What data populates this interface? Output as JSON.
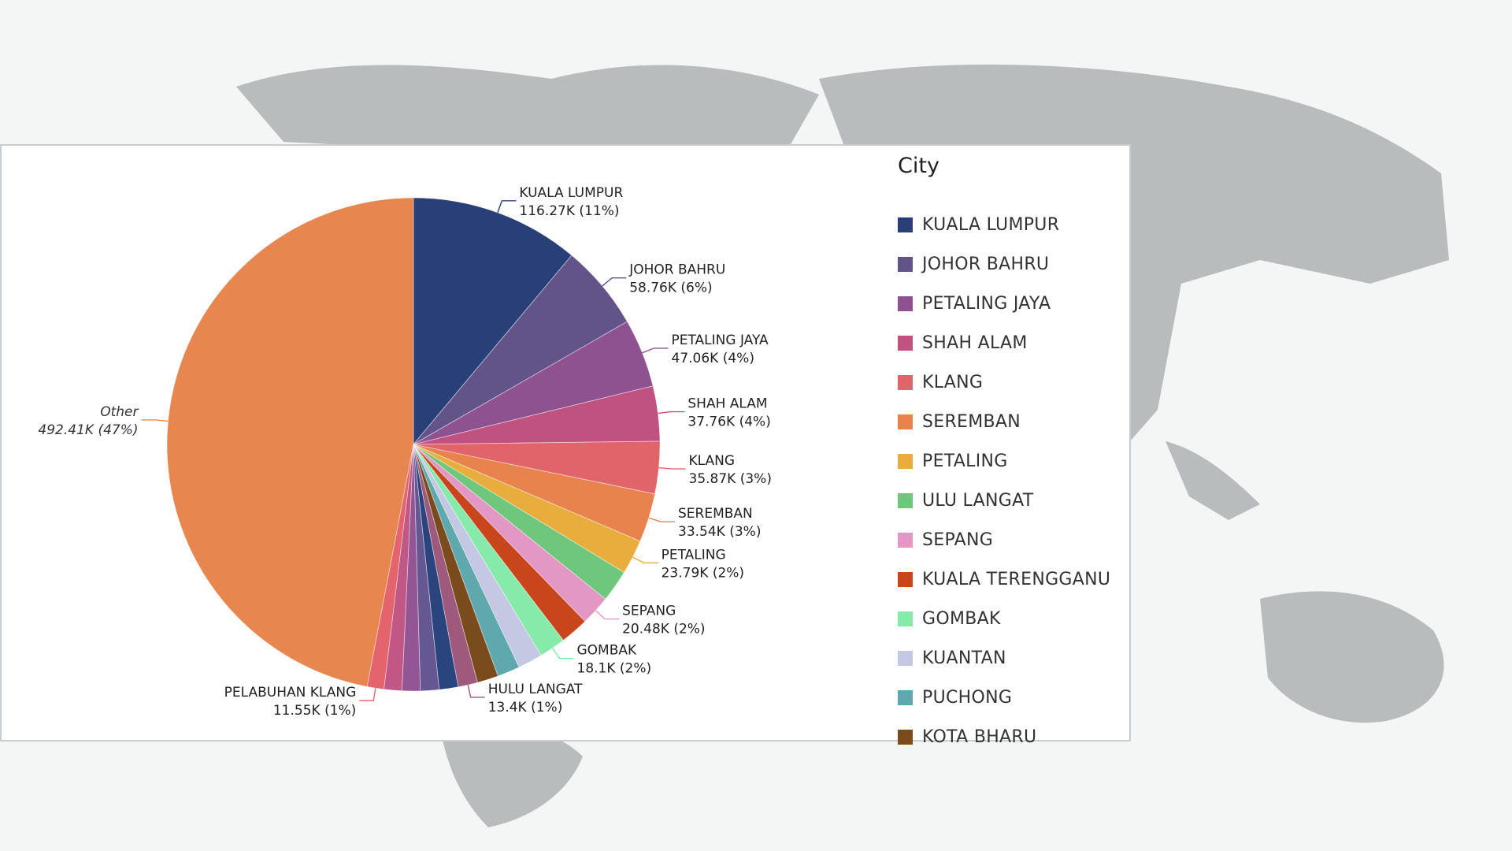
{
  "chart_data": {
    "type": "pie",
    "legend_title": "City",
    "legend_position": "right",
    "slices": [
      {
        "label": "KUALA LUMPUR",
        "value": 116270,
        "value_text": "116.27K (11%)",
        "color": "#283f77"
      },
      {
        "label": "JOHOR BAHRU",
        "value": 58760,
        "value_text": "58.76K (6%)",
        "color": "#625389"
      },
      {
        "label": "PETALING JAYA",
        "value": 47060,
        "value_text": "47.06K (4%)",
        "color": "#8f5291"
      },
      {
        "label": "SHAH ALAM",
        "value": 37760,
        "value_text": "37.76K (4%)",
        "color": "#bf527f"
      },
      {
        "label": "KLANG",
        "value": 35870,
        "value_text": "35.87K (3%)",
        "color": "#e1646a"
      },
      {
        "label": "SEREMBAN",
        "value": 33540,
        "value_text": "33.54K (3%)",
        "color": "#e8834d"
      },
      {
        "label": "PETALING",
        "value": 23790,
        "value_text": "23.79K (2%)",
        "color": "#e9ad3e"
      },
      {
        "label": "ULU LANGAT",
        "value": 22000,
        "value_text": "",
        "color": "#6fc77c"
      },
      {
        "label": "SEPANG",
        "value": 20480,
        "value_text": "20.48K (2%)",
        "color": "#e397c5"
      },
      {
        "label": "KUALA TERENGGANU",
        "value": 19500,
        "value_text": "",
        "color": "#c9461d"
      },
      {
        "label": "GOMBAK",
        "value": 18100,
        "value_text": "18.1K (2%)",
        "color": "#86eaaa"
      },
      {
        "label": "KUANTAN",
        "value": 17000,
        "value_text": "",
        "color": "#c5c8e3"
      },
      {
        "label": "PUCHONG",
        "value": 15500,
        "value_text": "",
        "color": "#5fa8ae"
      },
      {
        "label": "KOTA BHARU",
        "value": 14500,
        "value_text": "",
        "color": "#7a4b1c"
      },
      {
        "label": "HULU LANGAT",
        "value": 13400,
        "value_text": "13.4K (1%)",
        "color": "#9d5a7c"
      },
      {
        "label": "",
        "value": 13000,
        "value_text": "",
        "color": "#2a447e"
      },
      {
        "label": "",
        "value": 12800,
        "value_text": "",
        "color": "#655892"
      },
      {
        "label": "",
        "value": 12500,
        "value_text": "",
        "color": "#945595"
      },
      {
        "label": "",
        "value": 12200,
        "value_text": "",
        "color": "#c05784"
      },
      {
        "label": "PELABUHAN KLANG",
        "value": 11550,
        "value_text": "11.55K (1%)",
        "color": "#e3646c"
      },
      {
        "label": "Other",
        "value": 492410,
        "value_text": "492.41K (47%)",
        "color": "#e8864f"
      }
    ],
    "legend": [
      "KUALA LUMPUR",
      "JOHOR BAHRU",
      "PETALING JAYA",
      "SHAH ALAM",
      "KLANG",
      "SEREMBAN",
      "PETALING",
      "ULU LANGAT",
      "SEPANG",
      "KUALA TERENGGANU",
      "GOMBAK",
      "KUANTAN",
      "PUCHONG",
      "KOTA BHARU"
    ]
  }
}
